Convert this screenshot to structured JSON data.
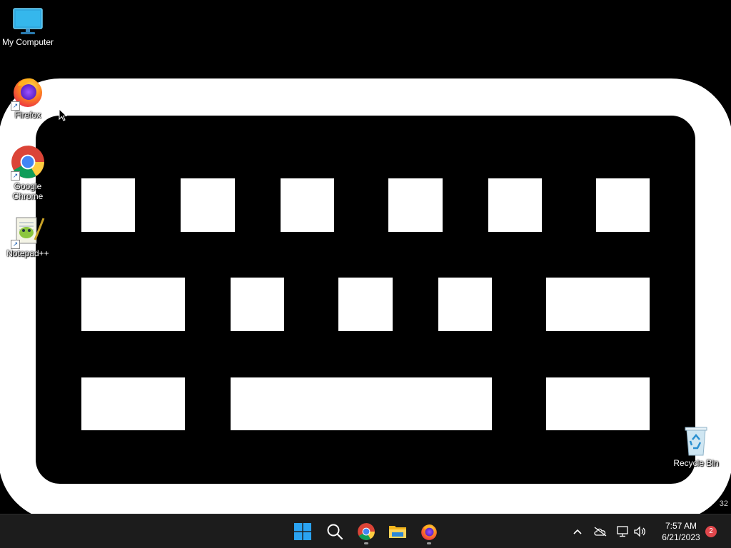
{
  "desktop": {
    "icons": [
      {
        "label": "My Computer",
        "icon": "monitor-icon"
      },
      {
        "label": "Firefox",
        "icon": "firefox-icon"
      },
      {
        "label": "Google Chrome",
        "icon": "chrome-icon"
      },
      {
        "label": "Notepad++",
        "icon": "notepad-plus-plus-icon"
      },
      {
        "label": "Recycle Bin",
        "icon": "recycle-bin-icon"
      }
    ],
    "wallpaper_icon": "keyboard-icon",
    "corner_text": "32"
  },
  "taskbar": {
    "apps": [
      {
        "name": "start",
        "icon": "windows-start-icon"
      },
      {
        "name": "search",
        "icon": "search-icon"
      },
      {
        "name": "chrome",
        "icon": "chrome-icon",
        "running": true
      },
      {
        "name": "file-explorer",
        "icon": "folder-icon"
      },
      {
        "name": "firefox",
        "icon": "firefox-icon",
        "running": true
      }
    ],
    "tray": {
      "icons": [
        "chevron-up-icon",
        "cloud-offline-icon",
        "network-icon",
        "speaker-icon"
      ]
    },
    "clock": {
      "time": "7:57 AM",
      "date": "6/21/2023"
    },
    "notification_count": "2"
  },
  "colors": {
    "background": "#000000",
    "taskbar": "#1c1c1c",
    "badge": "#e0474c"
  }
}
